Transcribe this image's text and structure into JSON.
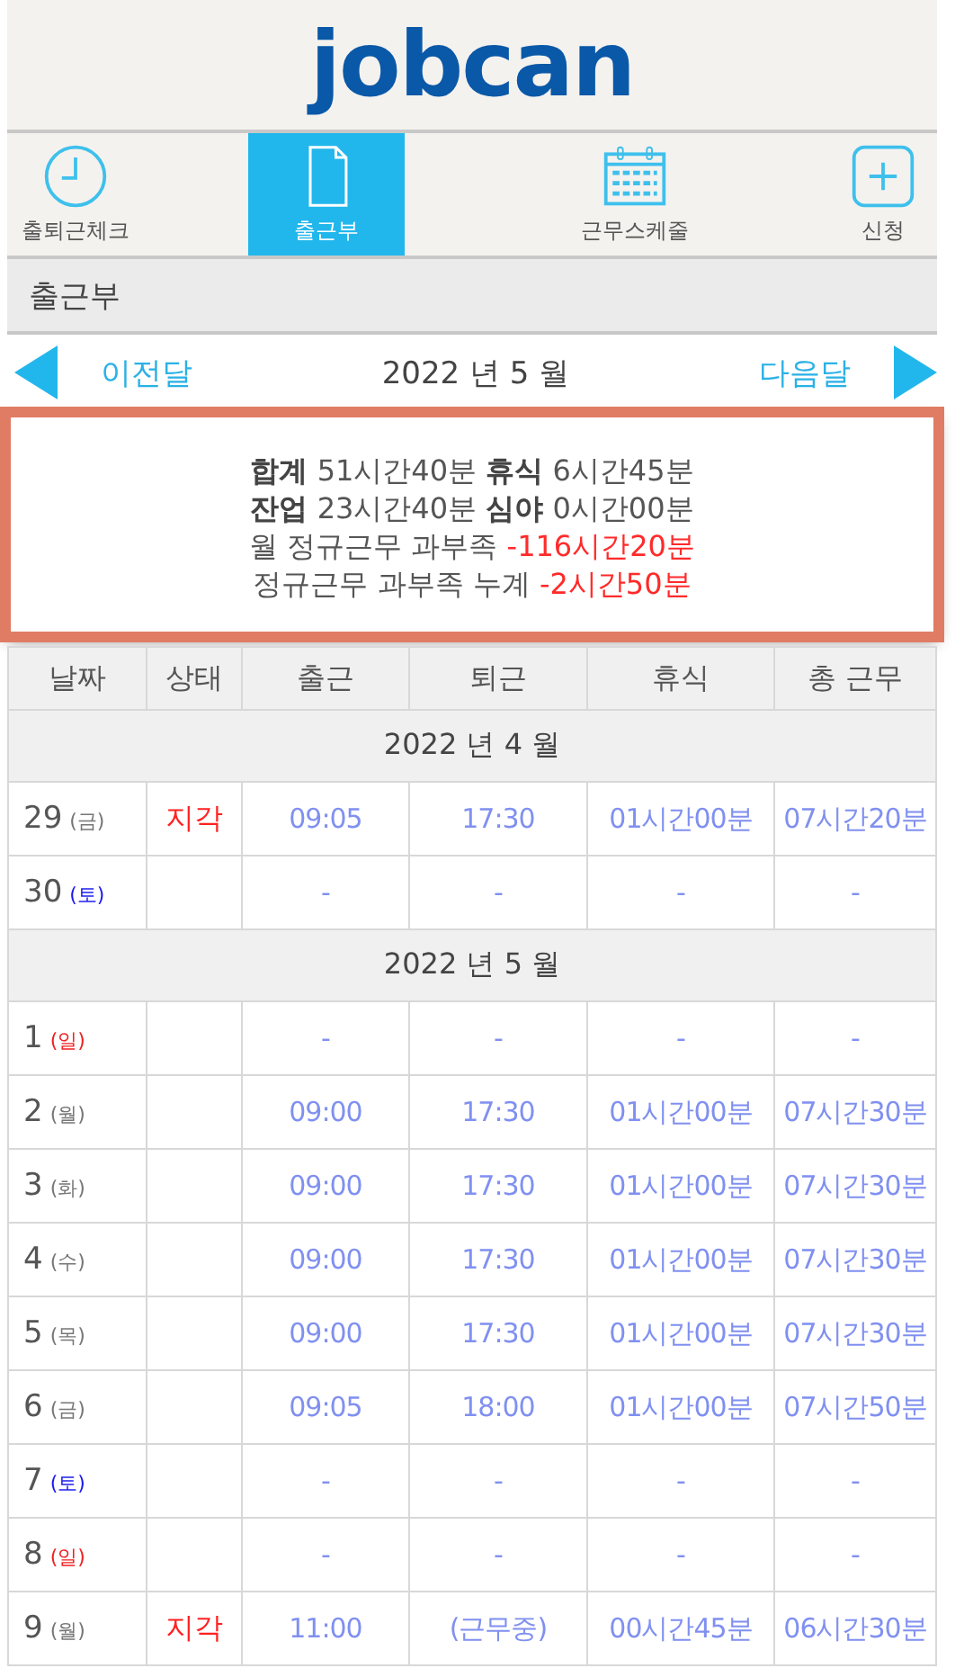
{
  "logo": "jobcan",
  "tabs": [
    {
      "label": "출퇴근체크",
      "selected": false
    },
    {
      "label": "출근부",
      "selected": true
    },
    {
      "label": "근무스케줄",
      "selected": false
    },
    {
      "label": "신청",
      "selected": false
    }
  ],
  "page_title": "출근부",
  "month_nav": {
    "prev": "이전달",
    "current": "2022 년 5 월",
    "next": "다음달"
  },
  "summary": {
    "highlighted": true,
    "lines": [
      {
        "text": "**합계** 51시간40분 **휴식** 6시간45분"
      },
      {
        "text": "**잔업** 23시간40분 **심야** 0시간00분"
      },
      {
        "text": "월 정규근무 과부족",
        "value": "-116시간20분",
        "alert": true
      },
      {
        "text": "정규근무 과부족 누계",
        "value": "-2시간50분",
        "alert": true
      }
    ]
  },
  "table": {
    "columns": [
      "날짜",
      "상태",
      "출근",
      "퇴근",
      "휴식",
      "총 근무"
    ],
    "rows": [
      {
        "kind": "month",
        "label": "2022 년 4 월"
      },
      {
        "kind": "day",
        "day": "29",
        "weekday": "(금)",
        "color": "#777777",
        "status": "지각",
        "cells": [
          "09:05",
          "17:30",
          "01시간00분",
          "07시간20분"
        ]
      },
      {
        "kind": "day",
        "day": "30",
        "weekday": "(토)",
        "color": "#1a1aee",
        "cells": [
          "-",
          "-",
          "-",
          "-"
        ]
      },
      {
        "kind": "month",
        "label": "2022 년 5 월"
      },
      {
        "kind": "day",
        "day": "1",
        "weekday": "(일)",
        "color": "#ee2222",
        "cells": [
          "-",
          "-",
          "-",
          "-"
        ]
      },
      {
        "kind": "day",
        "day": "2",
        "weekday": "(월)",
        "color": "#777777",
        "cells": [
          "09:00",
          "17:30",
          "01시간00분",
          "07시간30분"
        ]
      },
      {
        "kind": "day",
        "day": "3",
        "weekday": "(화)",
        "color": "#777777",
        "cells": [
          "09:00",
          "17:30",
          "01시간00분",
          "07시간30분"
        ]
      },
      {
        "kind": "day",
        "day": "4",
        "weekday": "(수)",
        "color": "#777777",
        "cells": [
          "09:00",
          "17:30",
          "01시간00분",
          "07시간30분"
        ]
      },
      {
        "kind": "day",
        "day": "5",
        "weekday": "(목)",
        "color": "#777777",
        "cells": [
          "09:00",
          "17:30",
          "01시간00분",
          "07시간30분"
        ]
      },
      {
        "kind": "day",
        "day": "6",
        "weekday": "(금)",
        "color": "#777777",
        "cells": [
          "09:05",
          "18:00",
          "01시간00분",
          "07시간50분"
        ]
      },
      {
        "kind": "day",
        "day": "7",
        "weekday": "(토)",
        "color": "#1a1aee",
        "cells": [
          "-",
          "-",
          "-",
          "-"
        ]
      },
      {
        "kind": "day",
        "day": "8",
        "weekday": "(일)",
        "color": "#ee2222",
        "cells": [
          "-",
          "-",
          "-",
          "-"
        ]
      },
      {
        "kind": "day",
        "day": "9",
        "weekday": "(월)",
        "color": "#777777",
        "status": "지각",
        "cells": [
          "11:00",
          "(근무중)",
          "00시간45분",
          "06시간30분"
        ]
      }
    ]
  }
}
